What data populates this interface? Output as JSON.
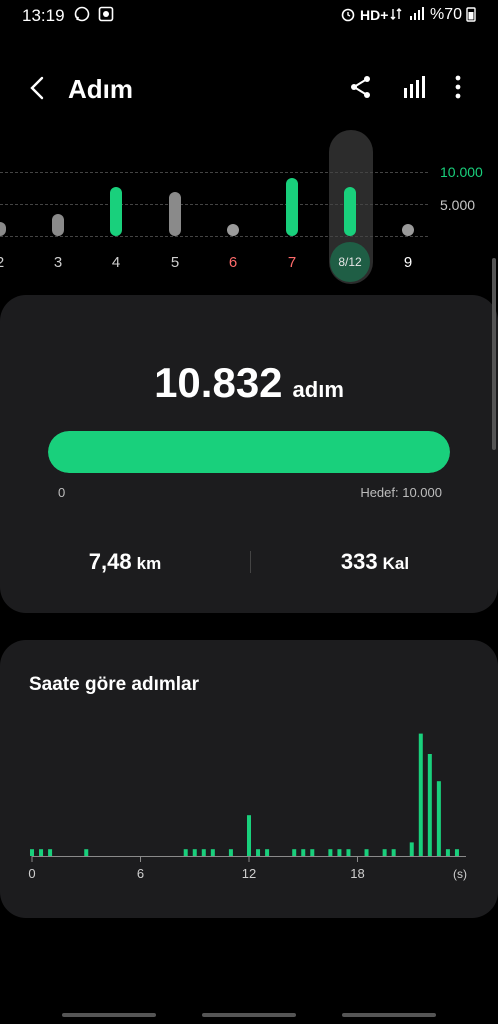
{
  "status": {
    "time": "13:19",
    "network": "HD+",
    "battery": "%70"
  },
  "header": {
    "title": "Adım"
  },
  "week": {
    "grid_labels": [
      "10.000",
      "5.000"
    ],
    "days": [
      {
        "label": "2",
        "steps": 2200,
        "color": "#8a8a8a",
        "label_color": "#cfcfcf"
      },
      {
        "label": "3",
        "steps": 3400,
        "color": "#8a8a8a",
        "label_color": "#cfcfcf"
      },
      {
        "label": "4",
        "steps": 7700,
        "color": "#19d07c",
        "label_color": "#cfcfcf"
      },
      {
        "label": "5",
        "steps": 6800,
        "color": "#8a8a8a",
        "label_color": "#cfcfcf"
      },
      {
        "label": "6",
        "steps": 0,
        "color": "#8a8a8a",
        "label_color": "#ff6b6b"
      },
      {
        "label": "7",
        "steps": 9000,
        "color": "#19d07c",
        "label_color": "#ff6b6b"
      },
      {
        "label": "8/12",
        "steps": 7700,
        "color": "#19d07c",
        "label_color": "#e6e6e6",
        "selected": true
      },
      {
        "label": "9",
        "steps": 0,
        "color": "#8a8a8a",
        "label_color": "#ffffff"
      }
    ]
  },
  "summary": {
    "steps": "10.832",
    "steps_unit": "adım",
    "progress": 1.0,
    "min_label": "0",
    "goal_label": "Hedef: 10.000",
    "distance": "7,48",
    "distance_unit": "km",
    "calories": "333",
    "calories_unit": "Kal"
  },
  "hourly": {
    "title": "Saate göre adımlar",
    "x_ticks": [
      "0",
      "6",
      "12",
      "18"
    ],
    "x_unit": "(s)",
    "color": "#19d07c"
  },
  "chart_data": {
    "type": "bar",
    "title": "Saate göre adımlar",
    "xlabel": "(s)",
    "ylabel": "",
    "x": [
      0,
      0.5,
      1,
      3,
      8.5,
      9,
      9.5,
      10,
      11,
      12,
      12.5,
      13,
      14.5,
      15,
      15.5,
      16.5,
      17,
      17.5,
      18.5,
      19.5,
      20,
      21,
      21.5,
      22,
      22.5,
      23,
      23.5
    ],
    "values": [
      1,
      1,
      1,
      1,
      1,
      1,
      1,
      1,
      1,
      6,
      1,
      1,
      1,
      1,
      1,
      1,
      1,
      1,
      1,
      1,
      1,
      2,
      18,
      15,
      11,
      1,
      1
    ]
  },
  "colors": {
    "accent": "#19d07c",
    "card": "#1c1c1e",
    "background": "#000000"
  }
}
